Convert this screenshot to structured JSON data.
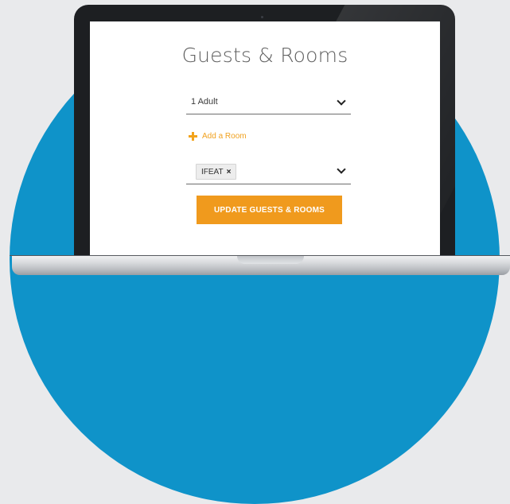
{
  "guests_rooms": {
    "title": "Guests & Rooms",
    "guests_select": {
      "value": "1 Adult"
    },
    "add_room": {
      "label": "Add a Room"
    },
    "promo_select": {
      "chip_label": "IFEAT",
      "chip_close": "×"
    },
    "update_button": {
      "label": "UPDATE GUESTS & ROOMS"
    }
  },
  "colors": {
    "accent": "#f09a1d",
    "background_circle": "#0f93c9",
    "laptop_bezel": "#1d1f22"
  },
  "icons": {
    "plus": "plus-icon",
    "dropdown": "chevron-down-icon",
    "close": "close-icon"
  }
}
